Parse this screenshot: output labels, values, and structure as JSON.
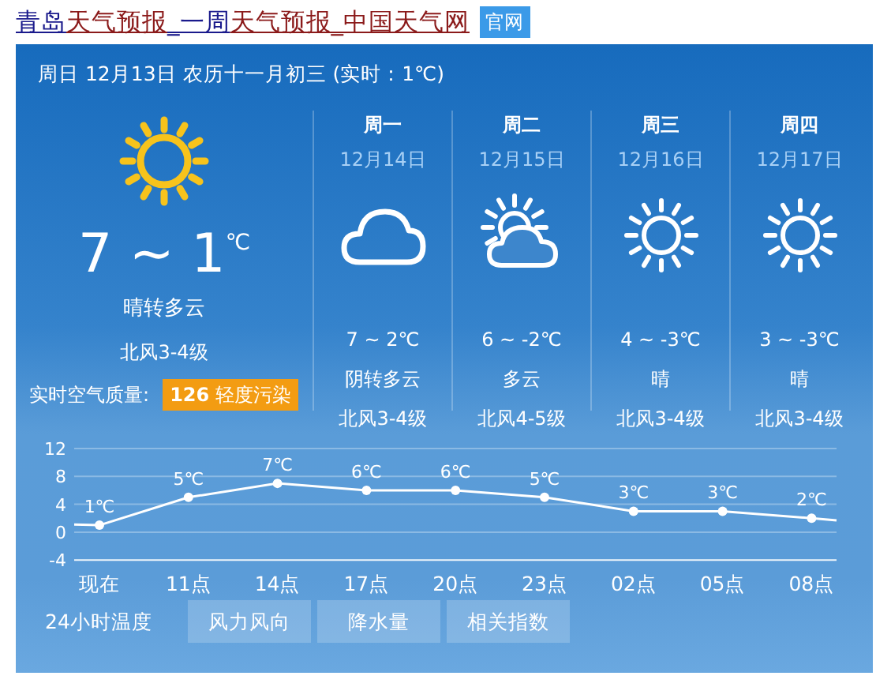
{
  "title": [
    {
      "text": "青岛",
      "highlight": false
    },
    {
      "text": "天气预报",
      "highlight": true
    },
    {
      "text": "_一周",
      "highlight": false
    },
    {
      "text": "天气预报_",
      "highlight": true
    },
    {
      "text": "中国天气网",
      "highlight": true
    }
  ],
  "official_badge": "官网",
  "header": "周日 12月13日 农历十一月初三 (实时：1℃)",
  "today": {
    "kind": "sunny",
    "temp": "7 ~ 1",
    "unit": "℃",
    "weather": "晴转多云",
    "wind": "北风3-4级",
    "aqi_label": "实时空气质量:",
    "aqi": "**126** 轻度污染"
  },
  "forecast": [
    {
      "day": "周一",
      "date": "12月14日",
      "kind": "cloudy",
      "temp": "7 ~ 2℃",
      "weather": "阴转多云",
      "wind": "北风3-4级"
    },
    {
      "day": "周二",
      "date": "12月15日",
      "kind": "partly_cloudy",
      "temp": "6 ~ -2℃",
      "weather": "多云",
      "wind": "北风4-5级"
    },
    {
      "day": "周三",
      "date": "12月16日",
      "kind": "sunny",
      "temp": "4 ~ -3℃",
      "weather": "晴",
      "wind": "北风3-4级"
    },
    {
      "day": "周四",
      "date": "12月17日",
      "kind": "sunny",
      "temp": "3 ~ -3℃",
      "weather": "晴",
      "wind": "北风3-4级"
    }
  ],
  "chart_data": {
    "type": "line",
    "categories": [
      "现在",
      "11点",
      "14点",
      "17点",
      "20点",
      "23点",
      "02点",
      "05点",
      "08点"
    ],
    "series": [
      {
        "color": "#ffffff",
        "marker": "circle",
        "values": [
          1,
          5,
          7,
          6,
          6,
          5,
          3,
          3,
          2
        ]
      }
    ],
    "grid": true,
    "yticks": [
      -4,
      0,
      4,
      8,
      12
    ],
    "ylim": [
      -4,
      12
    ],
    "value_labels": [
      "1℃",
      "5℃",
      "7℃",
      "6℃",
      "6℃",
      "5℃",
      "3℃",
      "3℃",
      "2℃"
    ]
  },
  "tabs": [
    {
      "label": "24小时温度",
      "selected": true
    },
    {
      "label": "风力风向",
      "selected": false
    },
    {
      "label": "降水量",
      "selected": false
    },
    {
      "label": "相关指数",
      "selected": false
    }
  ]
}
